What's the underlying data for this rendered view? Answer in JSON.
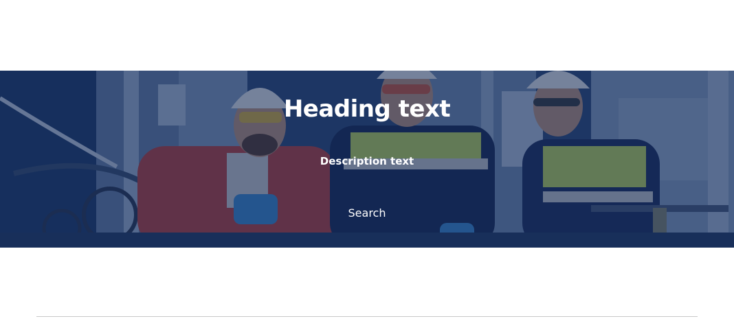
{
  "hero": {
    "heading": "Heading text",
    "description": "Description text",
    "search_label": "Search",
    "overlay_color": "#0e2654",
    "text_color": "#ffffff"
  },
  "page": {
    "background_color": "#ffffff",
    "divider_color": "#c9c9c9"
  }
}
